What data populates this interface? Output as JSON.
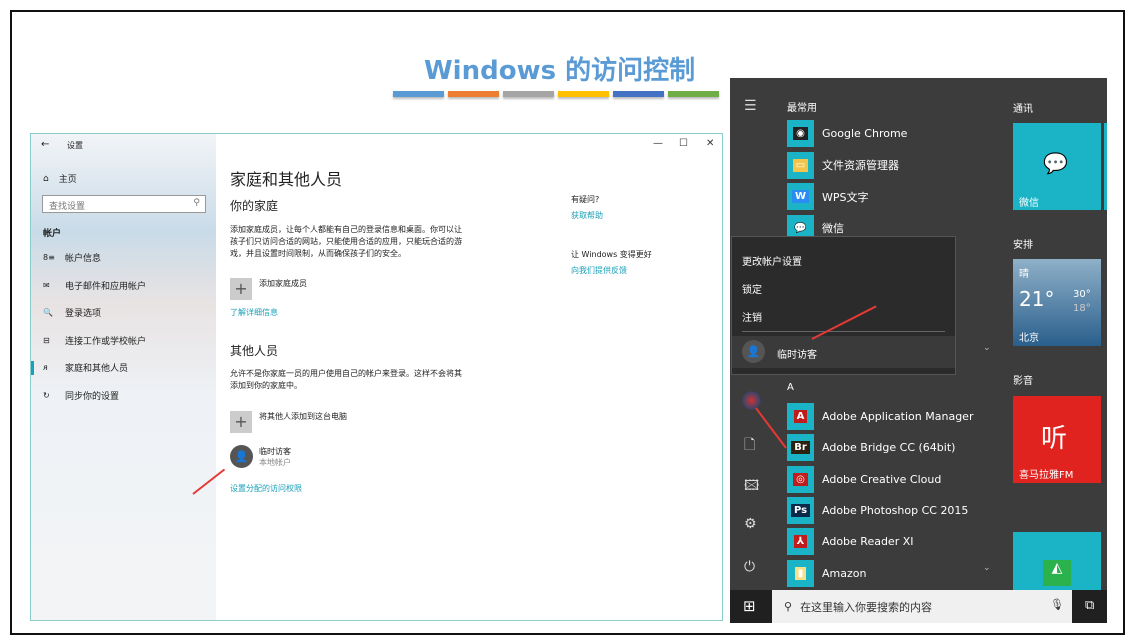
{
  "slide": {
    "title": "Windows 的访问控制",
    "bar_colors": [
      "#5b9bd5",
      "#ed7d31",
      "#a5a5a5",
      "#ffc000",
      "#4472c4",
      "#70ad47"
    ]
  },
  "settings": {
    "window_title": "设置",
    "minimize": "—",
    "maximize": "☐",
    "close": "✕",
    "home": "主页",
    "search_placeholder": "查找设置",
    "section": "帐户",
    "nav": [
      {
        "label": "帐户信息",
        "icon": "account-info-icon",
        "glyph": "8≡"
      },
      {
        "label": "电子邮件和应用帐户",
        "icon": "mail-icon",
        "glyph": "✉"
      },
      {
        "label": "登录选项",
        "icon": "key-icon",
        "glyph": "🔍"
      },
      {
        "label": "连接工作或学校帐户",
        "icon": "briefcase-icon",
        "glyph": "⊟"
      },
      {
        "label": "家庭和其他人员",
        "icon": "person-icon",
        "glyph": "ᴙ",
        "selected": true
      },
      {
        "label": "同步你的设置",
        "icon": "sync-icon",
        "glyph": "↻"
      }
    ],
    "page_title": "家庭和其他人员",
    "family_heading": "你的家庭",
    "family_desc": [
      "添加家庭成员，让每个人都能有自己的登录信息和桌面。你可以让",
      "孩子们只访问合适的网站，只能使用合适的应用，只能玩合适的游",
      "戏，并且设置时间限制，从而确保孩子们的安全。"
    ],
    "add_family": "添加家庭成员",
    "learn_more": "了解详细信息",
    "others_heading": "其他人员",
    "others_desc": [
      "允许不是你家庭一员的用户使用自己的帐户来登录。这样不会将其",
      "添加到你的家庭中。"
    ],
    "add_other": "将其他人添加到这台电脑",
    "user_name": "临时访客",
    "user_type": "本地帐户",
    "assigned_access": "设置分配的访问权限",
    "help_q": "有疑问?",
    "help_link": "获取帮助",
    "feedback_q": "让 Windows 变得更好",
    "feedback_link": "向我们提供反馈"
  },
  "start": {
    "most_used": "最常用",
    "apps_top": [
      {
        "label": "Google Chrome",
        "glyph": "◉"
      },
      {
        "label": "文件资源管理器",
        "glyph": "▭"
      },
      {
        "label": "WPS文字",
        "glyph": "W"
      },
      {
        "label": "微信",
        "glyph": "💬"
      }
    ],
    "account_menu": [
      "更改帐户设置",
      "锁定",
      "注销"
    ],
    "account_user": "临时访客",
    "letter_a": "A",
    "apps_a": [
      {
        "label": "Adobe Application Manager",
        "glyph": "A"
      },
      {
        "label": "Adobe Bridge CC (64bit)",
        "glyph": "Br"
      },
      {
        "label": "Adobe Creative Cloud",
        "glyph": "◎"
      },
      {
        "label": "Adobe Photoshop CC 2015",
        "glyph": "Ps"
      },
      {
        "label": "Adobe Reader XI",
        "glyph": "⅄"
      },
      {
        "label": "Amazon",
        "glyph": "▮"
      }
    ],
    "groups": {
      "comm": "通讯",
      "schedule": "安排",
      "media": "影音"
    },
    "tiles": {
      "wechat": "微信",
      "weather_cond": "晴",
      "weather_temp": "21°",
      "weather_hi": "30°",
      "weather_lo": "18°",
      "weather_city": "北京",
      "ximalaya": "喜马拉雅FM",
      "ximalaya_logo": "听"
    },
    "taskbar_search": "在这里输入你要搜索的内容"
  }
}
